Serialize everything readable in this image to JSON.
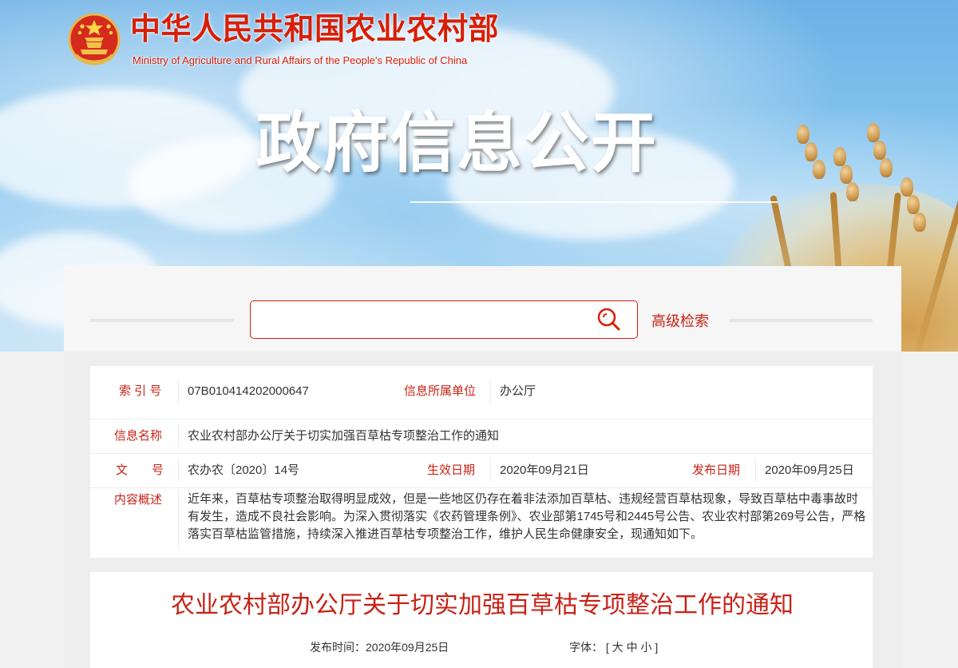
{
  "brand": {
    "ministry_cn": "中华人民共和国农业农村部",
    "ministry_en": "Ministry of Agriculture and Rural Affairs of the People's Republic of China",
    "colors": {
      "accent": "#d81e06",
      "label_red": "#c72216",
      "text": "#333333"
    }
  },
  "hero": {
    "title": "政府信息公开"
  },
  "search": {
    "placeholder": "",
    "value": "",
    "advanced_label": "高级检索",
    "icon": "search-icon"
  },
  "info": {
    "index_label": "索 引 号",
    "index_value": "07B010414202000647",
    "unit_label": "信息所属单位",
    "unit_value": "办公厅",
    "name_label": "信息名称",
    "name_value": "农业农村部办公厅关于切实加强百草枯专项整治工作的通知",
    "doc_label": "文　　号",
    "doc_value": "农办农〔2020〕14号",
    "effective_label": "生效日期",
    "effective_value": "2020年09月21日",
    "publish_label": "发布日期",
    "publish_value": "2020年09月25日",
    "summary_label": "内容概述",
    "summary_value": "近年来，百草枯专项整治取得明显成效，但是一些地区仍存在着非法添加百草枯、违规经营百草枯现象，导致百草枯中毒事故时有发生，造成不良社会影响。为深入贯彻落实《农药管理条例》、农业部第1745号和2445号公告、农业农村部第269号公告，严格落实百草枯监管措施，持续深入推进百草枯专项整治工作，维护人民生命健康安全，现通知如下。"
  },
  "article": {
    "title": "农业农村部办公厅关于切实加强百草枯专项整治工作的通知",
    "publish_time_label": "发布时间：",
    "publish_time_value": "2020年09月25日",
    "font_label": "字体：",
    "font_open": "[",
    "font_large": "大",
    "font_medium": "中",
    "font_small": "小",
    "font_close": "]"
  }
}
